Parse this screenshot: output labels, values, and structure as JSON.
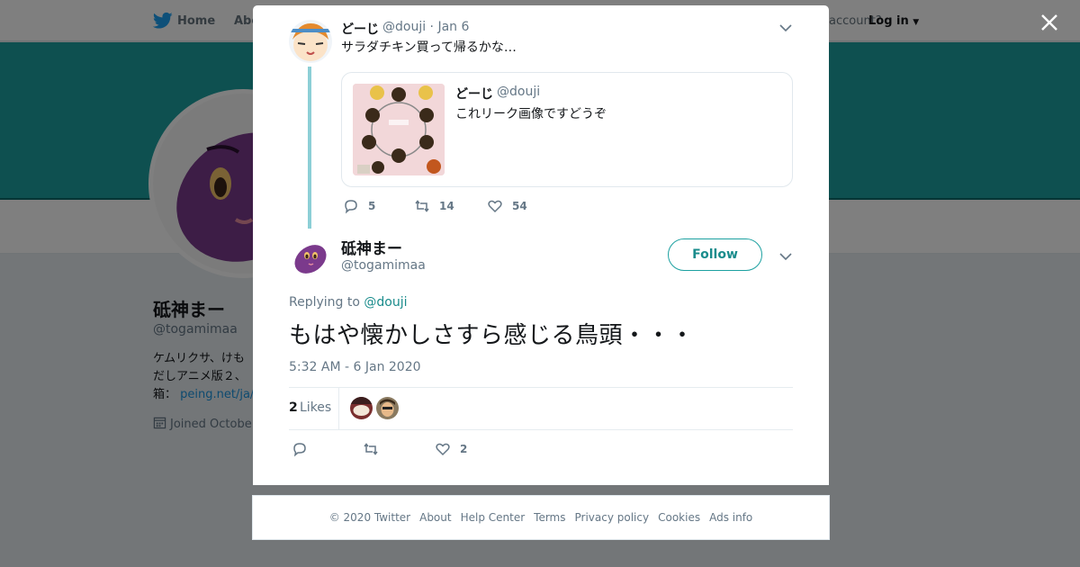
{
  "background": {
    "nav": {
      "home": "Home",
      "about": "Abo",
      "account": "account?",
      "login": "Log in"
    },
    "profile": {
      "name": "砥神まー",
      "handle": "@togamimaa",
      "bio_line1": "ケムリクサ、けも",
      "bio_line2": "だしアニメ版２、",
      "bio_line3_prefix": "箱：",
      "bio_link": "peing.net/ja/",
      "joined": "Joined Octobe"
    },
    "colors": {
      "banner": "#1da1a1",
      "accent": "#1a8c8c"
    }
  },
  "parent_tweet": {
    "name": "どーじ",
    "meta": "@douji · Jan 6",
    "text": "サラダチキン買って帰るかな…",
    "quote": {
      "name": "どーじ",
      "handle": "@douji",
      "text": "これリーク画像ですどうぞ"
    },
    "actions": {
      "replies": "5",
      "retweets": "14",
      "likes": "54"
    }
  },
  "main_tweet": {
    "name": "砥神まー",
    "handle": "@togamimaa",
    "follow_label": "Follow",
    "replying_prefix": "Replying to",
    "replying_to": "@douji",
    "text": "もはや懐かしさすら感じる鳥頭・・・",
    "timestamp": "5:32 AM - 6 Jan 2020",
    "likes_count": "2",
    "likes_label": "Likes",
    "actions": {
      "likes": "2"
    }
  },
  "footer": {
    "copyright": "© 2020 Twitter",
    "links": [
      "About",
      "Help Center",
      "Terms",
      "Privacy policy",
      "Cookies",
      "Ads info"
    ]
  },
  "icons": [
    "twitter-bird-icon",
    "close-icon",
    "chevron-down-icon",
    "reply-icon",
    "retweet-icon",
    "heart-icon",
    "calendar-icon"
  ]
}
